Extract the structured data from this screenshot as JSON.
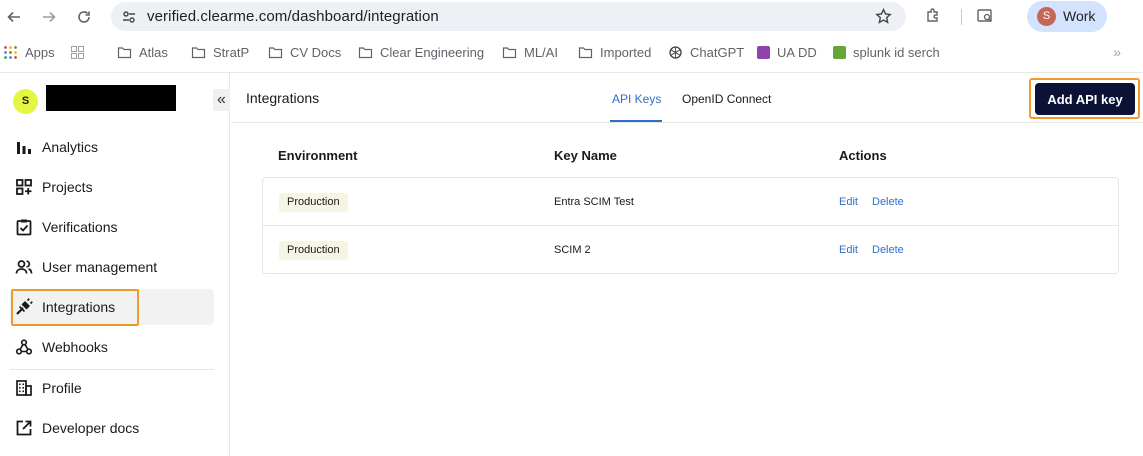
{
  "browser": {
    "url": "verified.clearme.com/dashboard/integration",
    "profile_initial": "S",
    "profile_label": "Work",
    "bookmarks": [
      {
        "label": "Apps",
        "icon": "apps-grid-icon"
      },
      {
        "label": "",
        "icon": "tab-groups-icon"
      },
      {
        "label": "Atlas",
        "icon": "folder-icon"
      },
      {
        "label": "StratP",
        "icon": "folder-icon"
      },
      {
        "label": "CV Docs",
        "icon": "folder-icon"
      },
      {
        "label": "Clear Engineering",
        "icon": "folder-icon"
      },
      {
        "label": "ML/AI",
        "icon": "folder-icon"
      },
      {
        "label": "Imported",
        "icon": "folder-icon"
      },
      {
        "label": "ChatGPT",
        "icon": "openai-icon"
      },
      {
        "label": "UA DD",
        "icon": "purple-favicon"
      },
      {
        "label": "splunk id serch",
        "icon": "splunk-favicon"
      }
    ],
    "bookmarks_overflow": "»"
  },
  "sidebar": {
    "org_initial": "S",
    "collapse_glyph": "«",
    "items": [
      {
        "label": "Analytics",
        "icon": "bar-chart-icon",
        "active": false
      },
      {
        "label": "Projects",
        "icon": "grid-plus-icon",
        "active": false
      },
      {
        "label": "Verifications",
        "icon": "clipboard-check-icon",
        "active": false
      },
      {
        "label": "User management",
        "icon": "users-icon",
        "active": false
      },
      {
        "label": "Integrations",
        "icon": "plug-icon",
        "active": true
      },
      {
        "label": "Webhooks",
        "icon": "webhook-icon",
        "active": false
      },
      {
        "label": "Profile",
        "icon": "building-icon",
        "active": false
      },
      {
        "label": "Developer docs",
        "icon": "external-link-icon",
        "active": false
      }
    ]
  },
  "main": {
    "title": "Integrations",
    "tabs": [
      {
        "label": "API Keys",
        "active": true
      },
      {
        "label": "OpenID Connect",
        "active": false
      }
    ],
    "add_button_label": "Add API key",
    "table": {
      "headers": [
        "Environment",
        "Key Name",
        "Actions"
      ],
      "rows": [
        {
          "environment": "Production",
          "key_name": "Entra SCIM Test",
          "edit": "Edit",
          "delete": "Delete"
        },
        {
          "environment": "Production",
          "key_name": "SCIM 2",
          "edit": "Edit",
          "delete": "Delete"
        }
      ]
    }
  },
  "colors": {
    "accent_blue": "#2f6fcc",
    "button_navy": "#0c1235",
    "highlight_orange": "#f19a2c",
    "badge_bg": "#f5f4e5",
    "org_avatar": "#e5f542"
  }
}
